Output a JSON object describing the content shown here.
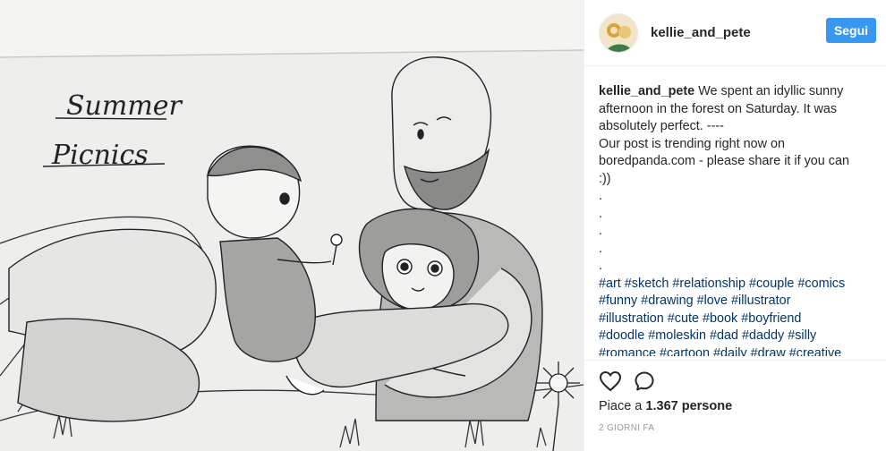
{
  "post": {
    "image_alt": "Pencil sketch: Summer Picnics",
    "drawing_title_line1": "Summer",
    "drawing_title_line2": "Picnics"
  },
  "header": {
    "username": "kellie_and_pete",
    "follow_label": "Segui"
  },
  "caption": {
    "username": "kellie_and_pete",
    "text_lines": [
      "We spent an idyllic sunny",
      "afternoon in the forest on Saturday. It was",
      "absolutely perfect. ----",
      "Our post is trending right now on",
      "boredpanda.com - please share it if you can",
      ":))",
      ".",
      ".",
      ".",
      ".",
      "."
    ],
    "hashtag_lines": [
      "#art #sketch #relationship #couple #comics",
      "#funny #drawing #love #illustrator",
      "#illustration #cute #book #boyfriend",
      "#doodle #moleskin #dad #daddy #silly",
      "#romance #cartoon #daily #draw #creative"
    ]
  },
  "actions": {
    "like_icon": "heart-icon",
    "comment_icon": "comment-icon",
    "likes_prefix": "Piace a ",
    "likes_count": "1.367 persone",
    "timestamp": "2 GIORNI FA"
  }
}
